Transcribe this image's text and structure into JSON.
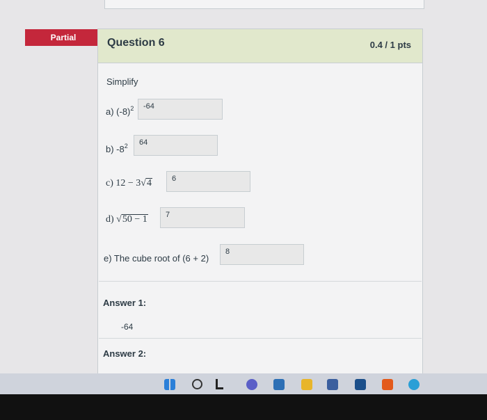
{
  "grading": {
    "status_label": "Partial"
  },
  "question": {
    "title": "Question 6",
    "points": "0.4 / 1 pts",
    "prompt": "Simplify",
    "items": [
      {
        "label": "a) (-8)",
        "exp": "2",
        "answer": "-64"
      },
      {
        "label": "b) -8",
        "exp": "2",
        "answer": "64"
      },
      {
        "prefix": "c) 12 − 3",
        "radical": "4",
        "answer": "6"
      },
      {
        "prefix": "d) ",
        "radical": "50 − 1",
        "answer": "7"
      },
      {
        "label": "e) The cube root of (6 + 2)",
        "answer": "8"
      }
    ]
  },
  "answers": [
    {
      "label": "Answer 1:",
      "value": "-64"
    },
    {
      "label": "Answer 2:"
    }
  ],
  "taskbar": {
    "icons": [
      "windows-start-icon",
      "search-icon",
      "task-view-icon",
      "chat-icon",
      "app-icon",
      "file-explorer-icon",
      "store-icon",
      "mail-icon",
      "office-icon",
      "edge-icon"
    ]
  }
}
